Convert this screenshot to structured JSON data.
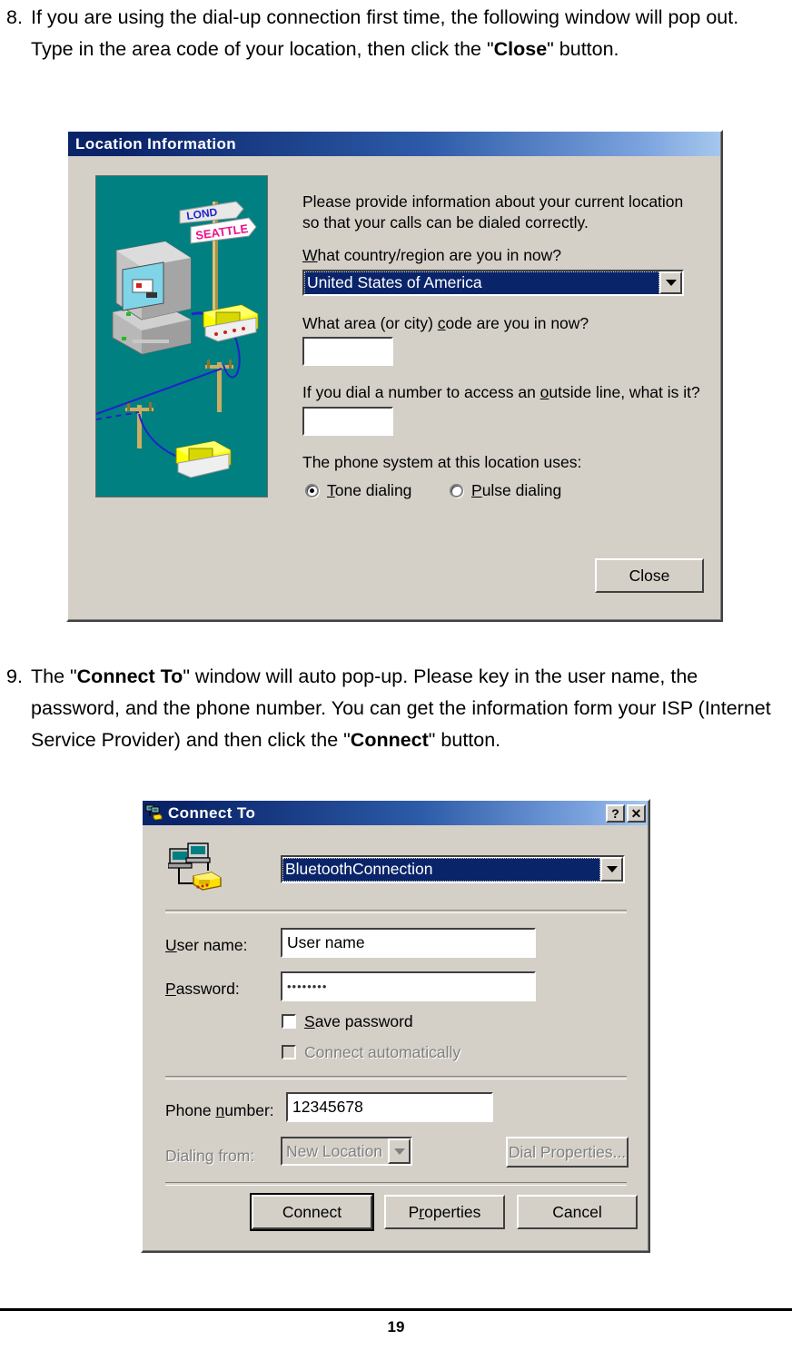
{
  "document": {
    "steps": [
      {
        "number": "8.",
        "runs": [
          {
            "text": "If you are using the dial-up connection first time, the following window will pop out. Type in the area code of your location, then click the \"",
            "bold": false
          },
          {
            "text": "Close",
            "bold": true
          },
          {
            "text": "\" button.",
            "bold": false
          }
        ]
      },
      {
        "number": "9.",
        "runs": [
          {
            "text": "The \"",
            "bold": false
          },
          {
            "text": "Connect To",
            "bold": true
          },
          {
            "text": "\" window will auto pop-up. Please key in the user name, the password, and the phone number. You can get the information form your ISP (Internet Service Provider) and then click the \"",
            "bold": false
          },
          {
            "text": "Connect",
            "bold": true
          },
          {
            "text": "\" button.",
            "bold": false
          }
        ]
      }
    ],
    "page_number": "19"
  },
  "location_dialog": {
    "title": "Location Information",
    "intro": "Please provide information about your current location so that your calls can be dialed correctly.",
    "country_question": "What country/region are you in now?",
    "country_value": "United States of America",
    "area_question": "What area (or city) code are you in now?",
    "area_value": "",
    "outside_question": "If you dial a number to access an outside line, what is it?",
    "outside_value": "",
    "phone_system_label": "The phone system at this location uses:",
    "tone_label": "Tone dialing",
    "pulse_label": "Pulse dialing",
    "tone_selected": true,
    "close_label": "Close",
    "illustration": {
      "background_color": "#008080",
      "sign_top_text": "LONDON",
      "sign_bottom_text": "SEATTLE",
      "sign_top_color": "#2222cc",
      "sign_bottom_color": "#ee1188",
      "phone_color": "#ffff00",
      "wire_color": "#2222cc"
    }
  },
  "connect_dialog": {
    "title": "Connect To",
    "help_button": "?",
    "close_button": "✕",
    "connection_value": "BluetoothConnection",
    "user_label": "User name:",
    "user_value": "User name",
    "password_label": "Password:",
    "password_value": "••••••••",
    "save_password_label": "Save password",
    "save_password_checked": false,
    "connect_automatically_label": "Connect automatically",
    "connect_automatically_checked": false,
    "connect_automatically_disabled": true,
    "phone_label": "Phone number:",
    "phone_value": "12345678",
    "dialing_from_label": "Dialing from:",
    "dialing_from_value": "New Location",
    "dial_properties_label": "Dial Properties...",
    "connect_label": "Connect",
    "properties_label": "Properties",
    "cancel_label": "Cancel"
  },
  "colors": {
    "dialog_face": "#d4d0c8",
    "title_gradient_start": "#0a246a",
    "title_gradient_end": "#a6c8ee",
    "selection_blue": "#0a246a",
    "illustration_teal": "#008080",
    "disabled_text": "#808080"
  }
}
